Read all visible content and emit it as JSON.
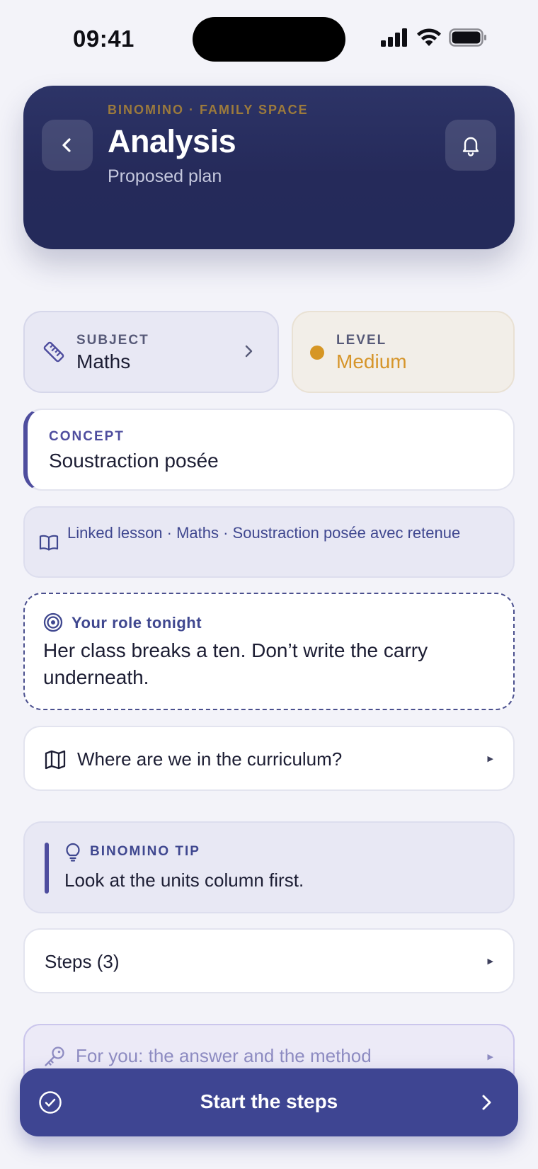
{
  "status_bar": {
    "time": "09:41",
    "icons": [
      "cellular-signal-icon",
      "wifi-icon",
      "battery-icon"
    ]
  },
  "header": {
    "eyebrow": "BINOMINO · FAMILY SPACE",
    "title": "Analysis",
    "subtitle": "Proposed plan",
    "back_icon": "chevron-left-icon",
    "bell_icon": "bell-icon"
  },
  "subject": {
    "label": "SUBJECT",
    "value": "Maths",
    "icon": "ruler-icon"
  },
  "level": {
    "label": "LEVEL",
    "value": "Medium",
    "color": "#d69624"
  },
  "concept": {
    "label": "CONCEPT",
    "value": "Soustraction posée"
  },
  "linked_lesson": {
    "text": "Linked lesson · Maths · Soustraction posée avec retenue",
    "icon": "book-icon"
  },
  "role": {
    "label": "Your role tonight",
    "text": "Her class breaks a ten. Don’t write the carry underneath.",
    "icon": "target-icon"
  },
  "curriculum": {
    "text": "Where are we in the curriculum?",
    "icon": "map-icon"
  },
  "tip": {
    "label": "BINOMINO TIP",
    "text": "Look at the units column first.",
    "icon": "lightbulb-icon"
  },
  "steps": {
    "text": "Steps (3)"
  },
  "for_you": {
    "text": "For you: the answer and the method",
    "icon": "key-icon"
  },
  "cta": {
    "label": "Start the steps",
    "icon": "check-circle-icon"
  },
  "colors": {
    "background": "#f3f3f9",
    "header": "#262b5c",
    "accent": "#3e4592",
    "level": "#d6952a"
  }
}
